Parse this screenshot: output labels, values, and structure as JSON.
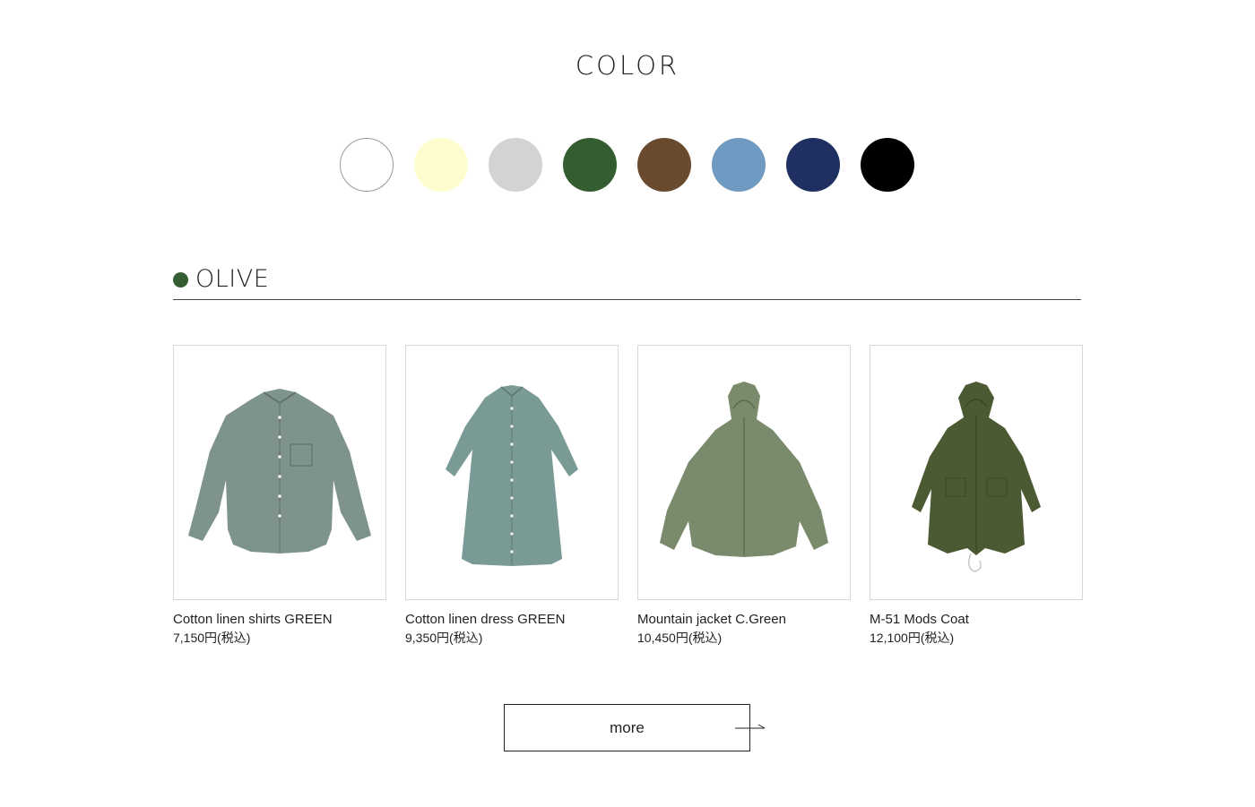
{
  "page_title": "COLOR",
  "swatches": [
    {
      "color": "#ffffff",
      "name": "white"
    },
    {
      "color": "#fefdd0",
      "name": "cream"
    },
    {
      "color": "#d3d3d3",
      "name": "gray"
    },
    {
      "color": "#345e32",
      "name": "olive"
    },
    {
      "color": "#6a4a2e",
      "name": "brown"
    },
    {
      "color": "#6f9bc2",
      "name": "light-blue"
    },
    {
      "color": "#1f2f62",
      "name": "navy"
    },
    {
      "color": "#000000",
      "name": "black"
    }
  ],
  "section": {
    "title": "OLIVE",
    "dot_color": "#345e32"
  },
  "products": [
    {
      "name": "Cotton linen shirts GREEN",
      "price": "7,150円(税込)",
      "garment_color": "#7e938a",
      "icon": "shirt-image"
    },
    {
      "name": "Cotton linen dress GREEN",
      "price": "9,350円(税込)",
      "garment_color": "#7a9a96",
      "icon": "dress-image"
    },
    {
      "name": "Mountain jacket C.Green",
      "price": "10,450円(税込)",
      "garment_color": "#7a8a6c",
      "icon": "jacket-image"
    },
    {
      "name": "M-51 Mods Coat",
      "price": "12,100円(税込)",
      "garment_color": "#4c5a34",
      "icon": "coat-image"
    }
  ],
  "more_label": "more"
}
